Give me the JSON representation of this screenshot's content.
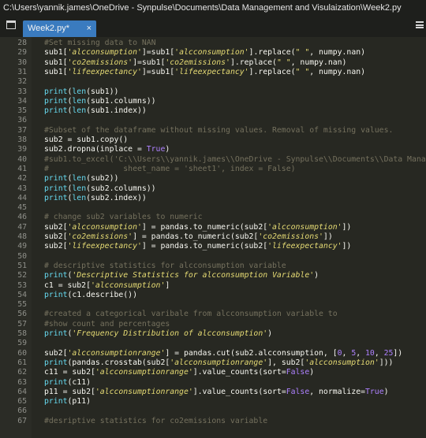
{
  "window": {
    "title": "C:\\Users\\yannik.james\\OneDrive - Synpulse\\Documents\\Data Management and Visulaization\\Week2.py"
  },
  "tabs": [
    {
      "label": "Week2.py*",
      "close": "×",
      "active": true
    }
  ],
  "icons": {
    "tab_list": "tab-list-icon",
    "menu": "hamburger-menu-icon",
    "close": "close-icon"
  },
  "colors": {
    "background": "#272822",
    "comment": "#75715e",
    "builtin": "#66d9ef",
    "string": "#e6db74",
    "number": "#ae81ff",
    "keyword": "#f92672",
    "tab_active": "#3a7bbf"
  },
  "editor": {
    "lines": [
      {
        "n": "28",
        "tokens": [
          {
            "t": "#Set missing data to NAN",
            "k": "cm"
          }
        ]
      },
      {
        "n": "29",
        "tokens": [
          {
            "t": "sub1[",
            "k": "pl"
          },
          {
            "t": "'alcconsumption'",
            "k": "str"
          },
          {
            "t": "]=sub1[",
            "k": "pl"
          },
          {
            "t": "'alcconsumption'",
            "k": "str"
          },
          {
            "t": "].replace(",
            "k": "pl"
          },
          {
            "t": "\" \"",
            "k": "sp"
          },
          {
            "t": ", numpy.nan)",
            "k": "pl"
          }
        ]
      },
      {
        "n": "30",
        "tokens": [
          {
            "t": "sub1[",
            "k": "pl"
          },
          {
            "t": "'co2emissions'",
            "k": "str"
          },
          {
            "t": "]=sub1[",
            "k": "pl"
          },
          {
            "t": "'co2emissions'",
            "k": "str"
          },
          {
            "t": "].replace(",
            "k": "pl"
          },
          {
            "t": "\" \"",
            "k": "sp"
          },
          {
            "t": ", numpy.nan)",
            "k": "pl"
          }
        ]
      },
      {
        "n": "31",
        "tokens": [
          {
            "t": "sub1[",
            "k": "pl"
          },
          {
            "t": "'lifeexpectancy'",
            "k": "str"
          },
          {
            "t": "]=sub1[",
            "k": "pl"
          },
          {
            "t": "'lifeexpectancy'",
            "k": "str"
          },
          {
            "t": "].replace(",
            "k": "pl"
          },
          {
            "t": "\" \"",
            "k": "sp"
          },
          {
            "t": ", numpy.nan)",
            "k": "pl"
          }
        ]
      },
      {
        "n": "32",
        "tokens": []
      },
      {
        "n": "33",
        "tokens": [
          {
            "t": "print",
            "k": "bi"
          },
          {
            "t": "(",
            "k": "pl"
          },
          {
            "t": "len",
            "k": "bi"
          },
          {
            "t": "(sub1))",
            "k": "pl"
          }
        ]
      },
      {
        "n": "34",
        "tokens": [
          {
            "t": "print",
            "k": "bi"
          },
          {
            "t": "(",
            "k": "pl"
          },
          {
            "t": "len",
            "k": "bi"
          },
          {
            "t": "(sub1.columns))",
            "k": "pl"
          }
        ]
      },
      {
        "n": "35",
        "tokens": [
          {
            "t": "print",
            "k": "bi"
          },
          {
            "t": "(",
            "k": "pl"
          },
          {
            "t": "len",
            "k": "bi"
          },
          {
            "t": "(sub1.index))",
            "k": "pl"
          }
        ]
      },
      {
        "n": "36",
        "tokens": []
      },
      {
        "n": "37",
        "tokens": [
          {
            "t": "#Subset of the dataframe without missing values. Removal of missing values.",
            "k": "cm"
          }
        ]
      },
      {
        "n": "38",
        "tokens": [
          {
            "t": "sub2 = sub1.copy()",
            "k": "pl"
          }
        ]
      },
      {
        "n": "39",
        "tokens": [
          {
            "t": "sub2.dropna(inplace = ",
            "k": "pl"
          },
          {
            "t": "True",
            "k": "num"
          },
          {
            "t": ")",
            "k": "pl"
          }
        ]
      },
      {
        "n": "40",
        "tokens": [
          {
            "t": "#sub1.to_excel('C:\\\\Users\\\\yannik.james\\\\OneDrive - Synpulse\\\\Documents\\\\Data Manag",
            "k": "cm"
          }
        ]
      },
      {
        "n": "41",
        "tokens": [
          {
            "t": "#                sheet_name = 'sheet1', index = False)",
            "k": "cm"
          }
        ]
      },
      {
        "n": "42",
        "tokens": [
          {
            "t": "print",
            "k": "bi"
          },
          {
            "t": "(",
            "k": "pl"
          },
          {
            "t": "len",
            "k": "bi"
          },
          {
            "t": "(sub2))",
            "k": "pl"
          }
        ]
      },
      {
        "n": "43",
        "tokens": [
          {
            "t": "print",
            "k": "bi"
          },
          {
            "t": "(",
            "k": "pl"
          },
          {
            "t": "len",
            "k": "bi"
          },
          {
            "t": "(sub2.columns))",
            "k": "pl"
          }
        ]
      },
      {
        "n": "44",
        "tokens": [
          {
            "t": "print",
            "k": "bi"
          },
          {
            "t": "(",
            "k": "pl"
          },
          {
            "t": "len",
            "k": "bi"
          },
          {
            "t": "(sub2.index))",
            "k": "pl"
          }
        ]
      },
      {
        "n": "45",
        "tokens": []
      },
      {
        "n": "46",
        "tokens": [
          {
            "t": "# change sub2 variables to numeric",
            "k": "cm"
          }
        ]
      },
      {
        "n": "47",
        "tokens": [
          {
            "t": "sub2[",
            "k": "pl"
          },
          {
            "t": "'alcconsumption'",
            "k": "str"
          },
          {
            "t": "] = pandas.to_numeric(sub2[",
            "k": "pl"
          },
          {
            "t": "'alcconsumption'",
            "k": "str"
          },
          {
            "t": "])",
            "k": "pl"
          }
        ]
      },
      {
        "n": "48",
        "tokens": [
          {
            "t": "sub2[",
            "k": "pl"
          },
          {
            "t": "'co2emissions'",
            "k": "str"
          },
          {
            "t": "] = pandas.to_numeric(sub2[",
            "k": "pl"
          },
          {
            "t": "'co2emissions'",
            "k": "str"
          },
          {
            "t": "])",
            "k": "pl"
          }
        ]
      },
      {
        "n": "49",
        "tokens": [
          {
            "t": "sub2[",
            "k": "pl"
          },
          {
            "t": "'lifeexpectancy'",
            "k": "str"
          },
          {
            "t": "] = pandas.to_numeric(sub2[",
            "k": "pl"
          },
          {
            "t": "'lifeexpectancy'",
            "k": "str"
          },
          {
            "t": "])",
            "k": "pl"
          }
        ]
      },
      {
        "n": "50",
        "tokens": []
      },
      {
        "n": "51",
        "tokens": [
          {
            "t": "# descriptive statistics for alcconsumption variable",
            "k": "cm"
          }
        ]
      },
      {
        "n": "52",
        "tokens": [
          {
            "t": "print",
            "k": "bi"
          },
          {
            "t": "(",
            "k": "pl"
          },
          {
            "t": "'Descriptive Statistics for alcconsumption Variable'",
            "k": "str"
          },
          {
            "t": ")",
            "k": "pl"
          }
        ]
      },
      {
        "n": "53",
        "tokens": [
          {
            "t": "c1 = sub2[",
            "k": "pl"
          },
          {
            "t": "'alcconsumption'",
            "k": "str"
          },
          {
            "t": "]",
            "k": "pl"
          }
        ]
      },
      {
        "n": "54",
        "tokens": [
          {
            "t": "print",
            "k": "bi"
          },
          {
            "t": "(c1.describe())",
            "k": "pl"
          }
        ]
      },
      {
        "n": "55",
        "tokens": []
      },
      {
        "n": "56",
        "tokens": [
          {
            "t": "#created a categorical varibale from alcconsumption variable to",
            "k": "cm"
          }
        ]
      },
      {
        "n": "57",
        "tokens": [
          {
            "t": "#show count and percentages",
            "k": "cm"
          }
        ]
      },
      {
        "n": "58",
        "tokens": [
          {
            "t": "print",
            "k": "bi"
          },
          {
            "t": "(",
            "k": "pl"
          },
          {
            "t": "'Frequency Distribution of alcconsumption'",
            "k": "str"
          },
          {
            "t": ")",
            "k": "pl"
          }
        ]
      },
      {
        "n": "59",
        "tokens": []
      },
      {
        "n": "60",
        "tokens": [
          {
            "t": "sub2[",
            "k": "pl"
          },
          {
            "t": "'alcconsumptionrange'",
            "k": "str"
          },
          {
            "t": "] = pandas.cut(sub2.alcconsumption, [",
            "k": "pl"
          },
          {
            "t": "0",
            "k": "num"
          },
          {
            "t": ", ",
            "k": "pl"
          },
          {
            "t": "5",
            "k": "num"
          },
          {
            "t": ", ",
            "k": "pl"
          },
          {
            "t": "10",
            "k": "num"
          },
          {
            "t": ", ",
            "k": "pl"
          },
          {
            "t": "25",
            "k": "num"
          },
          {
            "t": "])",
            "k": "pl"
          }
        ]
      },
      {
        "n": "61",
        "tokens": [
          {
            "t": "print",
            "k": "bi"
          },
          {
            "t": "(pandas.crosstab(sub2[",
            "k": "pl"
          },
          {
            "t": "'alcconsumptionrange'",
            "k": "str"
          },
          {
            "t": "], sub2[",
            "k": "pl"
          },
          {
            "t": "'alcconsumption'",
            "k": "str"
          },
          {
            "t": "]))",
            "k": "pl"
          }
        ]
      },
      {
        "n": "62",
        "tokens": [
          {
            "t": "c11 = sub2[",
            "k": "pl"
          },
          {
            "t": "'alcconsumptionrange'",
            "k": "str"
          },
          {
            "t": "].value_counts(sort=",
            "k": "pl"
          },
          {
            "t": "False",
            "k": "num"
          },
          {
            "t": ")",
            "k": "pl"
          }
        ]
      },
      {
        "n": "63",
        "tokens": [
          {
            "t": "print",
            "k": "bi"
          },
          {
            "t": "(c11)",
            "k": "pl"
          }
        ]
      },
      {
        "n": "64",
        "tokens": [
          {
            "t": "p11 = sub2[",
            "k": "pl"
          },
          {
            "t": "'alcconsumptionrange'",
            "k": "str"
          },
          {
            "t": "].value_counts(sort=",
            "k": "pl"
          },
          {
            "t": "False",
            "k": "num"
          },
          {
            "t": ", normalize=",
            "k": "pl"
          },
          {
            "t": "True",
            "k": "num"
          },
          {
            "t": ")",
            "k": "pl"
          }
        ]
      },
      {
        "n": "65",
        "tokens": [
          {
            "t": "print",
            "k": "bi"
          },
          {
            "t": "(p11)",
            "k": "pl"
          }
        ]
      },
      {
        "n": "66",
        "tokens": []
      },
      {
        "n": "67",
        "tokens": [
          {
            "t": "#desriptive statistics for co2emissions variable",
            "k": "cm"
          }
        ]
      }
    ]
  }
}
